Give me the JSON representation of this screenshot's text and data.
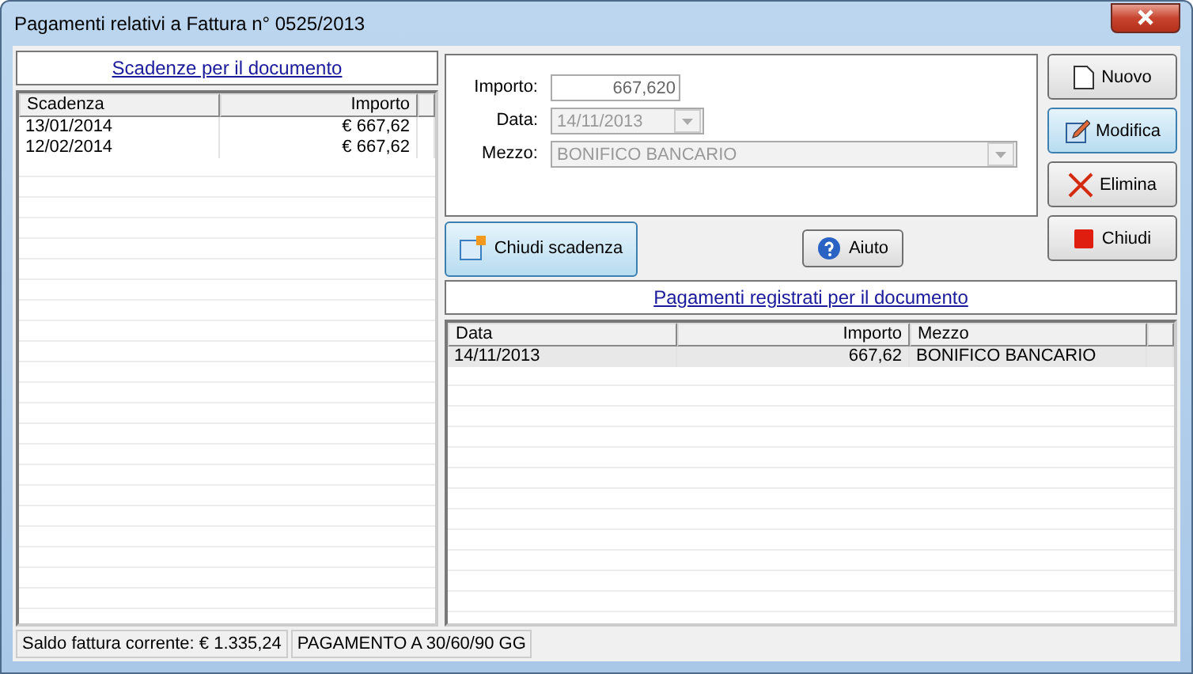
{
  "window": {
    "title": "Pagamenti relativi a Fattura n° 0525/2013"
  },
  "scadenze": {
    "heading": "Scadenze per il documento",
    "columns": [
      "Scadenza",
      "Importo"
    ],
    "rows": [
      {
        "cells": [
          "13/01/2014",
          "€ 667,62"
        ]
      },
      {
        "cells": [
          "12/02/2014",
          "€ 667,62"
        ]
      }
    ]
  },
  "form": {
    "fields": [
      {
        "label": "Importo:",
        "value": "667,620",
        "kind": "text",
        "disabled": false
      },
      {
        "label": "Data:",
        "value": "14/11/2013",
        "kind": "dropdown",
        "disabled": true
      },
      {
        "label": "Mezzo:",
        "value": "BONIFICO BANCARIO",
        "kind": "dropdown",
        "disabled": true
      }
    ]
  },
  "actions": [
    {
      "label": "Chiudi scadenza",
      "highlighted": true
    },
    {
      "label": "Aiuto",
      "highlighted": false
    }
  ],
  "side_buttons": [
    {
      "label": "Nuovo",
      "highlighted": false
    },
    {
      "label": "Modifica",
      "highlighted": true
    },
    {
      "label": "Elimina",
      "highlighted": false
    },
    {
      "label": "Chiudi",
      "highlighted": false
    }
  ],
  "pagamenti": {
    "heading": "Pagamenti registrati per il documento",
    "columns": [
      "Data",
      "Importo",
      "Mezzo"
    ],
    "rows": [
      {
        "cells": [
          "14/11/2013",
          "667,62",
          "BONIFICO BANCARIO"
        ],
        "selected": true
      }
    ]
  },
  "status_bar": [
    "Saldo fattura corrente: € 1.335,24",
    "PAGAMENTO A 30/60/90 GG"
  ]
}
